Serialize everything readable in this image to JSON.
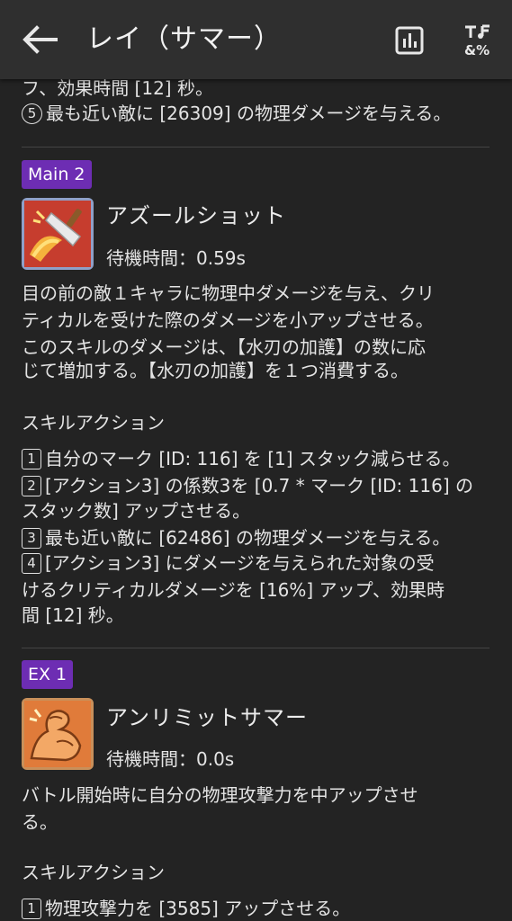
{
  "header": {
    "title": "レイ（サマー）",
    "back_icon": "arrow-left-icon",
    "stats_icon": "bar-chart-icon",
    "translate_icon": "translate-icon"
  },
  "previous_skill": {
    "lines": [
      "フ、効果時間 [12] 秒。",
      "最も近い敵に [26309] の物理ダメージを与える。"
    ],
    "line2_number": "5"
  },
  "skills": [
    {
      "badge": "Main 2",
      "name": "アズールショット",
      "cast_time": "待機時間：0.59s",
      "description": [
        "目の前の敵１キャラに物理中ダメージを与え、クリ",
        "ティカルを受けた際のダメージを小アップさせる。",
        "このスキルのダメージは、【水刃の加護】の数に応",
        "じて増加する。【水刃の加護】を１つ消費する。"
      ],
      "actions_title": "スキルアクション",
      "actions": [
        {
          "num": "1",
          "lines": [
            "自分のマーク [ID: 116] を [1] スタック減らせる。"
          ]
        },
        {
          "num": "2",
          "lines": [
            "[アクション3] の係数3を [0.7 * マーク [ID: 116] の",
            "スタック数] アップさせる。"
          ]
        },
        {
          "num": "3",
          "lines": [
            "最も近い敵に [62486] の物理ダメージを与える。"
          ]
        },
        {
          "num": "4",
          "lines": [
            "[アクション3] にダメージを与えられた対象の受",
            "けるクリティカルダメージを [16%] アップ、効果時",
            "間 [12] 秒。"
          ]
        }
      ],
      "icon": "sword-slash-icon",
      "colors": {
        "badge": "#6d2db3",
        "icon_bg": "#c63d2e",
        "icon_border": "#8fa0c8"
      }
    },
    {
      "badge": "EX 1",
      "name": "アンリミットサマー",
      "cast_time": "待機時間：0.0s",
      "description": [
        "バトル開始時に自分の物理攻撃力を中アップさせ",
        "る。"
      ],
      "actions_title": "スキルアクション",
      "actions": [
        {
          "num": "1",
          "lines": [
            "物理攻撃力を [3585] アップさせる。"
          ]
        }
      ],
      "icon": "flexed-arm-icon",
      "colors": {
        "badge": "#6d2db3",
        "icon_bg": "#e07b3a",
        "icon_border": "#c9905a"
      }
    }
  ]
}
